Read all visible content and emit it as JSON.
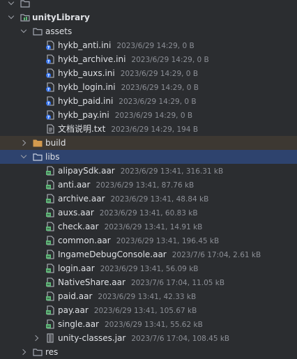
{
  "project": {
    "module_name": "unityLibrary",
    "folders": {
      "assets": "assets",
      "build": "build",
      "libs": "libs",
      "res": "res"
    },
    "assets_files": [
      {
        "name": "hykb_anti.ini",
        "meta": "2023/6/29 14:29, 0 B"
      },
      {
        "name": "hykb_archive.ini",
        "meta": "2023/6/29 14:29, 0 B"
      },
      {
        "name": "hykb_auxs.ini",
        "meta": "2023/6/29 14:29, 0 B"
      },
      {
        "name": "hykb_login.ini",
        "meta": "2023/6/29 14:29, 0 B"
      },
      {
        "name": "hykb_paid.ini",
        "meta": "2023/6/29 14:29, 0 B"
      },
      {
        "name": "hykb_pay.ini",
        "meta": "2023/6/29 14:29, 0 B"
      },
      {
        "name": "文档说明.txt",
        "meta": "2023/6/29 14:29, 194 B"
      }
    ],
    "libs_files": [
      {
        "name": "alipaySdk.aar",
        "meta": "2023/6/29 13:41, 316.31 kB"
      },
      {
        "name": "anti.aar",
        "meta": "2023/6/29 13:41, 87.76 kB"
      },
      {
        "name": "archive.aar",
        "meta": "2023/6/29 13:41, 48.84 kB"
      },
      {
        "name": "auxs.aar",
        "meta": "2023/6/29 13:41, 60.83 kB"
      },
      {
        "name": "check.aar",
        "meta": "2023/6/29 13:41, 14.91 kB"
      },
      {
        "name": "common.aar",
        "meta": "2023/6/29 13:41, 196.45 kB"
      },
      {
        "name": "IngameDebugConsole.aar",
        "meta": "2023/7/6 17:04, 2.61 kB"
      },
      {
        "name": "login.aar",
        "meta": "2023/6/29 13:41, 56.09 kB"
      },
      {
        "name": "NativeShare.aar",
        "meta": "2023/7/6 17:04, 11.05 kB"
      },
      {
        "name": "paid.aar",
        "meta": "2023/6/29 13:41, 42.33 kB"
      },
      {
        "name": "pay.aar",
        "meta": "2023/6/29 13:41, 105.67 kB"
      },
      {
        "name": "single.aar",
        "meta": "2023/6/29 13:41, 55.62 kB"
      }
    ],
    "jar_file": {
      "name": "unity-classes.jar",
      "meta": "2023/7/6 17:04, 108.45 kB"
    }
  },
  "colors": {
    "background": "#2b2d30",
    "selection": "#2e436e",
    "excluded_band": "#3d3832",
    "folder": "#a3a8b2",
    "excluded_folder": "#d39a4e",
    "aar_icon": "#5fb878"
  }
}
